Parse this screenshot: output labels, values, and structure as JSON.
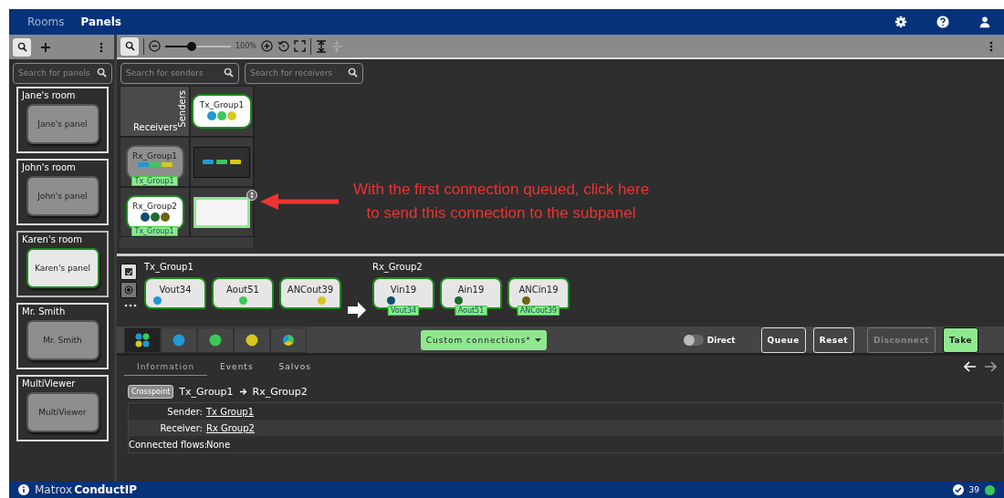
{
  "nav": {
    "tabs": [
      {
        "label": "Rooms",
        "selected": false
      },
      {
        "label": "Panels",
        "selected": true
      }
    ]
  },
  "sidebar": {
    "search": {
      "placeholder": "Search for panels"
    },
    "rooms": [
      {
        "name": "Jane's room",
        "panel": "Jane's panel",
        "selected": false
      },
      {
        "name": "John's room",
        "panel": "John's panel",
        "selected": false
      },
      {
        "name": "Karen's room",
        "panel": "Karen's panel",
        "selected": true
      },
      {
        "name": "Mr. Smith",
        "panel": "Mr. Smith",
        "selected": false
      },
      {
        "name": "MultiViewer",
        "panel": "MultiViewer",
        "selected": false
      }
    ]
  },
  "toolbar": {
    "zoom": {
      "level": 0.4,
      "reading": "100%"
    }
  },
  "sender_search": {
    "placeholder": "Search for senders"
  },
  "receiver_search": {
    "placeholder": "Search for receivers"
  },
  "matrix": {
    "senders_label": "Senders",
    "receivers_label": "Receivers",
    "sender": {
      "name": "Tx_Group1",
      "dots": [
        {
          "color": "#1e9ad6"
        },
        {
          "color": "#3cc75a"
        },
        {
          "color": "#d6c81e"
        }
      ]
    },
    "receivers": [
      {
        "name": "Rx_Group1",
        "tag": "Tx_Group1",
        "selected": false,
        "kind": "connected",
        "dots": [
          {
            "color": "#1e9ad6"
          },
          {
            "color": "#3cc75a"
          },
          {
            "color": "#d6c81e"
          }
        ]
      },
      {
        "name": "Rx_Group2",
        "tag": "Tx_Group1",
        "selected": true,
        "kind": "queued",
        "dots": [
          {
            "color": "#0d4f6e"
          },
          {
            "color": "#1f6b2f"
          },
          {
            "color": "#6b6410"
          }
        ]
      }
    ]
  },
  "annotation": {
    "lines": [
      "With the first connection queued, click here",
      "to send this connection to the subpanel"
    ]
  },
  "detail": {
    "sender": {
      "name": "Tx_Group1",
      "flows": [
        {
          "name": "Vout34",
          "color": "#1e9ad6"
        },
        {
          "name": "Aout51",
          "color": "#3cc75a"
        },
        {
          "name": "ANCout39",
          "color": "#d6c81e"
        }
      ]
    },
    "receiver": {
      "name": "Rx_Group2",
      "flows": [
        {
          "name": "Vin19",
          "color": "#0d4f6e",
          "tag": "Vout34"
        },
        {
          "name": "Ain19",
          "color": "#1f6b2f",
          "tag": "Aout51"
        },
        {
          "name": "ANCin19",
          "color": "#6b6410",
          "tag": "ANCout39"
        }
      ]
    }
  },
  "filters": [
    {
      "kind": "all",
      "selected": true
    },
    {
      "kind": "dot",
      "color": "#1e9ad6",
      "selected": false
    },
    {
      "kind": "dot",
      "color": "#3cc75a",
      "selected": false
    },
    {
      "kind": "dot",
      "color": "#d6c81e",
      "selected": false
    },
    {
      "kind": "pie",
      "selected": false
    }
  ],
  "connections_menu": {
    "label": "Custom connections*"
  },
  "direct": {
    "label": "Direct",
    "on": false
  },
  "actions": [
    {
      "label": "Queue",
      "kind": "outline",
      "disabled": false
    },
    {
      "label": "Reset",
      "kind": "outline",
      "disabled": false
    },
    {
      "label": "Disconnect",
      "kind": "outline",
      "disabled": true
    },
    {
      "label": "Take",
      "kind": "primary",
      "disabled": false
    }
  ],
  "info_tabs": [
    {
      "label": "Information",
      "selected": true
    },
    {
      "label": "Events",
      "selected": false
    },
    {
      "label": "Salvos",
      "selected": false
    }
  ],
  "crosspoint": {
    "badge": "Crosspoint",
    "from": "Tx_Group1",
    "to": "Rx_Group2"
  },
  "info_rows": [
    {
      "label": "Sender:",
      "value": "Tx Group1",
      "link": true
    },
    {
      "label": "Receiver:",
      "value": "Rx Group2",
      "link": true
    },
    {
      "label": "Connected flows:",
      "value": "None",
      "link": false
    }
  ],
  "footer": {
    "brand": "Matrox",
    "product": "ConductIP",
    "count": "39"
  }
}
